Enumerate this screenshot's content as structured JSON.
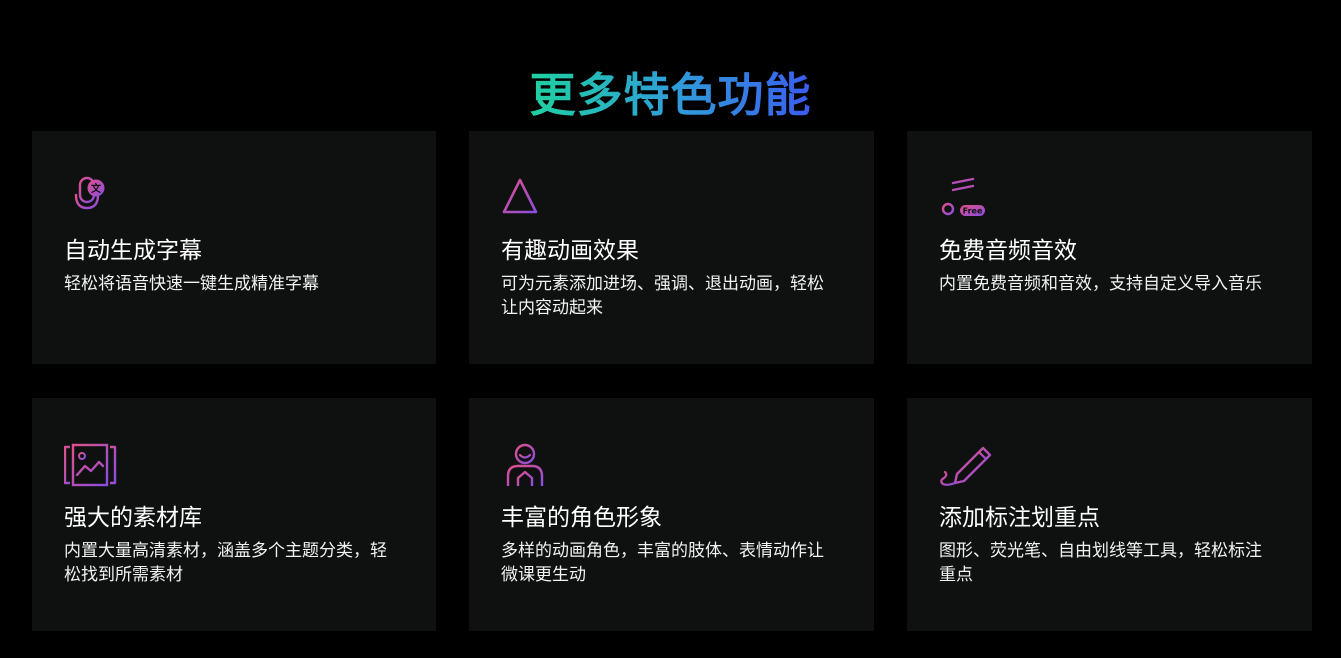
{
  "section": {
    "title": "更多特色功能"
  },
  "colors": {
    "background": "#000000",
    "card_background": "#0f1111",
    "title_gradient": [
      "#1fd1a0",
      "#2f9fd8",
      "#3a5cf0"
    ],
    "icon_gradient": [
      "#e0508a",
      "#8a4de0"
    ]
  },
  "features": [
    {
      "icon": "subtitle-microphone-icon",
      "title": "自动生成字幕",
      "desc": "轻松将语音快速一键生成精准字幕"
    },
    {
      "icon": "animation-triangle-icon",
      "title": "有趣动画效果",
      "desc": "可为元素添加进场、强调、退出动画，轻松让内容动起来"
    },
    {
      "icon": "free-music-icon",
      "title": "免费音频音效",
      "desc": "内置免费音频和音效，支持自定义导入音乐",
      "icon_badge": "Free"
    },
    {
      "icon": "image-library-icon",
      "title": "强大的素材库",
      "desc": "内置大量高清素材，涵盖多个主题分类，轻松找到所需素材"
    },
    {
      "icon": "character-icon",
      "title": "丰富的角色形象",
      "desc": "多样的动画角色，丰富的肢体、表情动作让微课更生动"
    },
    {
      "icon": "highlighter-pen-icon",
      "title": "添加标注划重点",
      "desc": "图形、荧光笔、自由划线等工具，轻松标注重点"
    }
  ]
}
